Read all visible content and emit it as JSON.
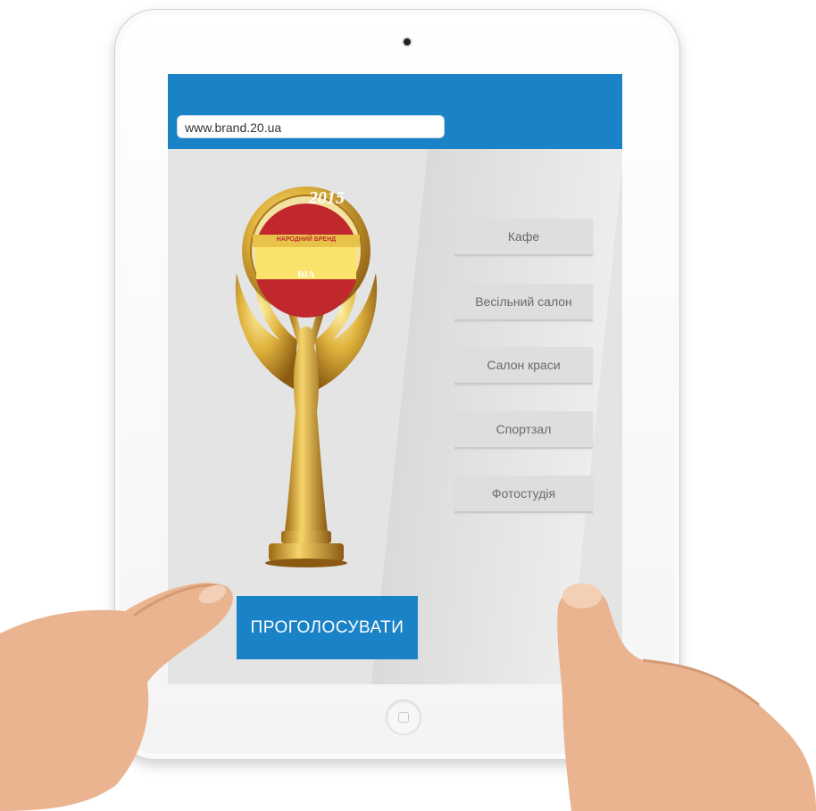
{
  "browser": {
    "url": "www.brand.20.ua"
  },
  "categories": [
    {
      "label": "Кафе"
    },
    {
      "label": "Весільний салон"
    },
    {
      "label": "Салон краси"
    },
    {
      "label": "Спортзал"
    },
    {
      "label": "Фотостудія"
    }
  ],
  "vote_button": {
    "label": "ПРОГОЛОСУВАТИ"
  },
  "award": {
    "year": "2015",
    "ribbon_text": "НАРОДНИЙ БРЕНД",
    "seal_text": "ВІА"
  },
  "colors": {
    "accent": "#1a82c6",
    "screen_bg": "#e4e4e4",
    "menu_bg": "#dedede",
    "medal_red": "#c0282d",
    "gold": "#d4a53a"
  }
}
